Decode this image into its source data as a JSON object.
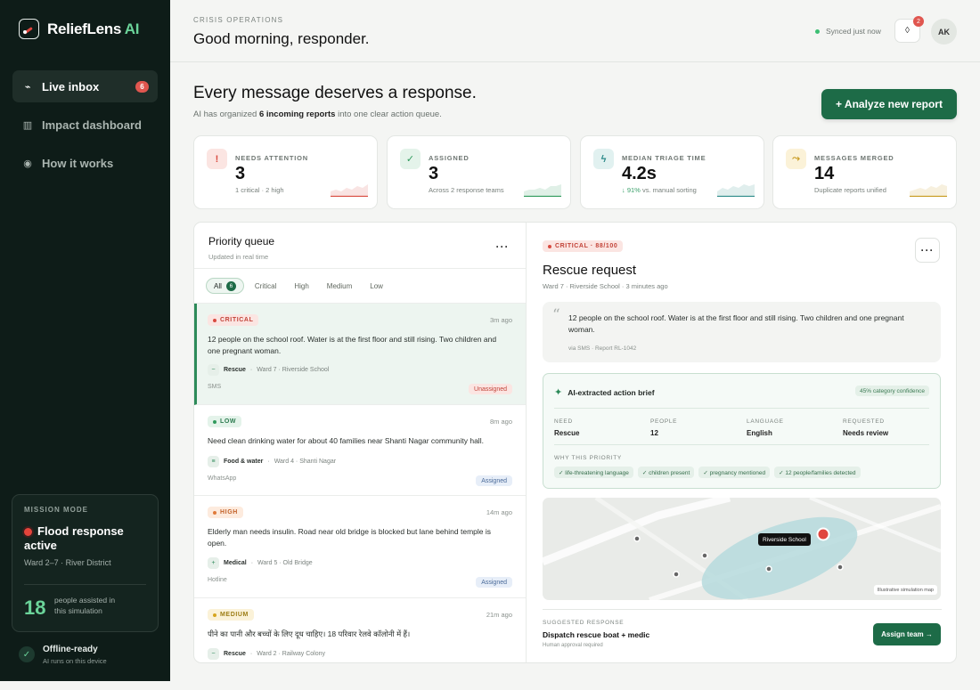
{
  "app": {
    "name": "ReliefLens",
    "name_accent": "AI"
  },
  "nav": [
    {
      "label": "Live inbox",
      "icon": "pulse-icon",
      "badge": "6",
      "active": true
    },
    {
      "label": "Impact dashboard",
      "icon": "columns-icon"
    },
    {
      "label": "How it works",
      "icon": "info-icon"
    }
  ],
  "mission": {
    "label": "MISSION MODE",
    "title_line1": "Flood response",
    "title_line2": "active",
    "area": "Ward 2–7 · River District",
    "count": "18",
    "count_label": "people assisted in this simulation"
  },
  "offline": {
    "title": "Offline-ready",
    "subtitle": "AI runs on this device"
  },
  "header": {
    "eyebrow": "CRISIS OPERATIONS",
    "greeting": "Good morning, responder.",
    "synced": "Synced just now",
    "notifications": "2",
    "avatar": "AK"
  },
  "hero": {
    "title": "Every message deserves a response.",
    "sub_pre": "AI has organized ",
    "sub_bold": "6 incoming reports",
    "sub_post": " into one clear action queue.",
    "analyze_label": "+ Analyze new report"
  },
  "stats": [
    {
      "label": "NEEDS ATTENTION",
      "value": "3",
      "sub": "1 critical · 2 high",
      "icon": "!",
      "color": "#d94b40",
      "bg": "#fbe5e2",
      "spark": [
        2,
        3,
        2,
        4,
        3,
        5,
        4,
        6
      ]
    },
    {
      "label": "ASSIGNED",
      "value": "3",
      "sub": "Across 2 response teams",
      "icon": "✓",
      "color": "#2f9a5c",
      "bg": "#e4f3ea",
      "spark": [
        2,
        3,
        3,
        4,
        3,
        5,
        5,
        6
      ]
    },
    {
      "label": "MEDIAN TRIAGE TIME",
      "value": "4.2s",
      "sub_arrow": "↓ 91%",
      "sub": " vs. manual sorting",
      "icon": "ϟ",
      "color": "#2c8a89",
      "bg": "#e1f1f0",
      "spark": [
        2,
        4,
        3,
        5,
        4,
        6,
        5,
        6
      ]
    },
    {
      "label": "MESSAGES MERGED",
      "value": "14",
      "sub": "Duplicate reports unified",
      "icon": "⤳",
      "color": "#c89a1f",
      "bg": "#fbf2d8",
      "spark": [
        2,
        3,
        4,
        3,
        5,
        4,
        6,
        5
      ]
    }
  ],
  "queue": {
    "title": "Priority queue",
    "subtitle": "Updated in real time",
    "filters": [
      {
        "label": "All",
        "count": "6",
        "active": true
      },
      {
        "label": "Critical"
      },
      {
        "label": "High"
      },
      {
        "label": "Medium"
      },
      {
        "label": "Low"
      }
    ],
    "items": [
      {
        "priority": "CRITICAL",
        "time": "3m ago",
        "text": "12 people on the school roof. Water is at the first floor and still rising. Two children and one pregnant woman.",
        "category": "Rescue",
        "cat_icon": "~",
        "location": "Ward 7 · Riverside School",
        "source": "SMS",
        "status": "Unassigned"
      },
      {
        "priority": "LOW",
        "time": "8m ago",
        "text": "Need clean drinking water for about 40 families near Shanti Nagar community hall.",
        "category": "Food & water",
        "cat_icon": "≡",
        "location": "Ward 4 · Shanti Nagar",
        "source": "WhatsApp",
        "status": "Assigned"
      },
      {
        "priority": "HIGH",
        "time": "14m ago",
        "text": "Elderly man needs insulin. Road near old bridge is blocked but lane behind temple is open.",
        "category": "Medical",
        "cat_icon": "+",
        "location": "Ward 5 · Old Bridge",
        "source": "Hotline",
        "status": "Assigned"
      },
      {
        "priority": "MEDIUM",
        "time": "21m ago",
        "text": "पीने का पानी और बच्चों के लिए दूध चाहिए। 18 परिवार रेलवे कॉलोनी में हैं।",
        "category": "Rescue",
        "cat_icon": "~",
        "location": "Ward 2 · Railway Colony",
        "source": "",
        "status": ""
      }
    ]
  },
  "detail": {
    "badge": "CRITICAL · 88/100",
    "title": "Rescue request",
    "subtitle": "Ward 7 · Riverside School · 3 minutes ago",
    "quote": "12 people on the school roof. Water is at the first floor and still rising. Two children and one pregnant woman.",
    "quote_source": "via SMS · Report RL-1042",
    "brief": {
      "title": "AI-extracted action brief",
      "confidence": "45% category confidence",
      "fields": [
        {
          "key": "NEED",
          "value": "Rescue"
        },
        {
          "key": "PEOPLE",
          "value": "12"
        },
        {
          "key": "LANGUAGE",
          "value": "English"
        },
        {
          "key": "REQUESTED",
          "value": "Needs review"
        }
      ],
      "why_label": "WHY THIS PRIORITY",
      "tags": [
        "✓ life-threatening language",
        "✓ children present",
        "✓ pregnancy mentioned",
        "✓ 12 people/families detected"
      ]
    },
    "map": {
      "label": "Riverside School",
      "caption": "Illustrative simulation map"
    },
    "suggested": {
      "label": "SUGGESTED RESPONSE",
      "value": "Dispatch rescue boat + medic",
      "note": "Human approval required",
      "button": "Assign team →"
    }
  }
}
